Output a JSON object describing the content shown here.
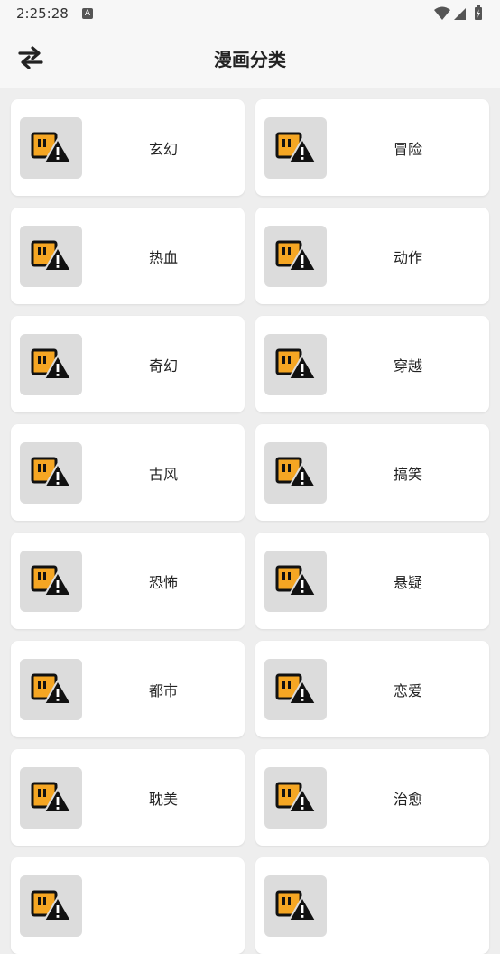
{
  "status_bar": {
    "time": "2:25:28",
    "notification_letter": "A",
    "icons": [
      "wifi-icon",
      "signal-icon",
      "battery-icon"
    ]
  },
  "app_bar": {
    "title": "漫画分类",
    "left_icon": "swap-arrows-icon"
  },
  "categories": [
    {
      "label": "玄幻"
    },
    {
      "label": "冒险"
    },
    {
      "label": "热血"
    },
    {
      "label": "动作"
    },
    {
      "label": "奇幻"
    },
    {
      "label": "穿越"
    },
    {
      "label": "古风"
    },
    {
      "label": "搞笑"
    },
    {
      "label": "恐怖"
    },
    {
      "label": "悬疑"
    },
    {
      "label": "都市"
    },
    {
      "label": "恋爱"
    },
    {
      "label": "耽美"
    },
    {
      "label": "治愈"
    },
    {
      "label": ""
    },
    {
      "label": ""
    }
  ],
  "colors": {
    "placeholder_orange": "#f5a623",
    "background": "#eeeeee",
    "card": "#ffffff"
  }
}
